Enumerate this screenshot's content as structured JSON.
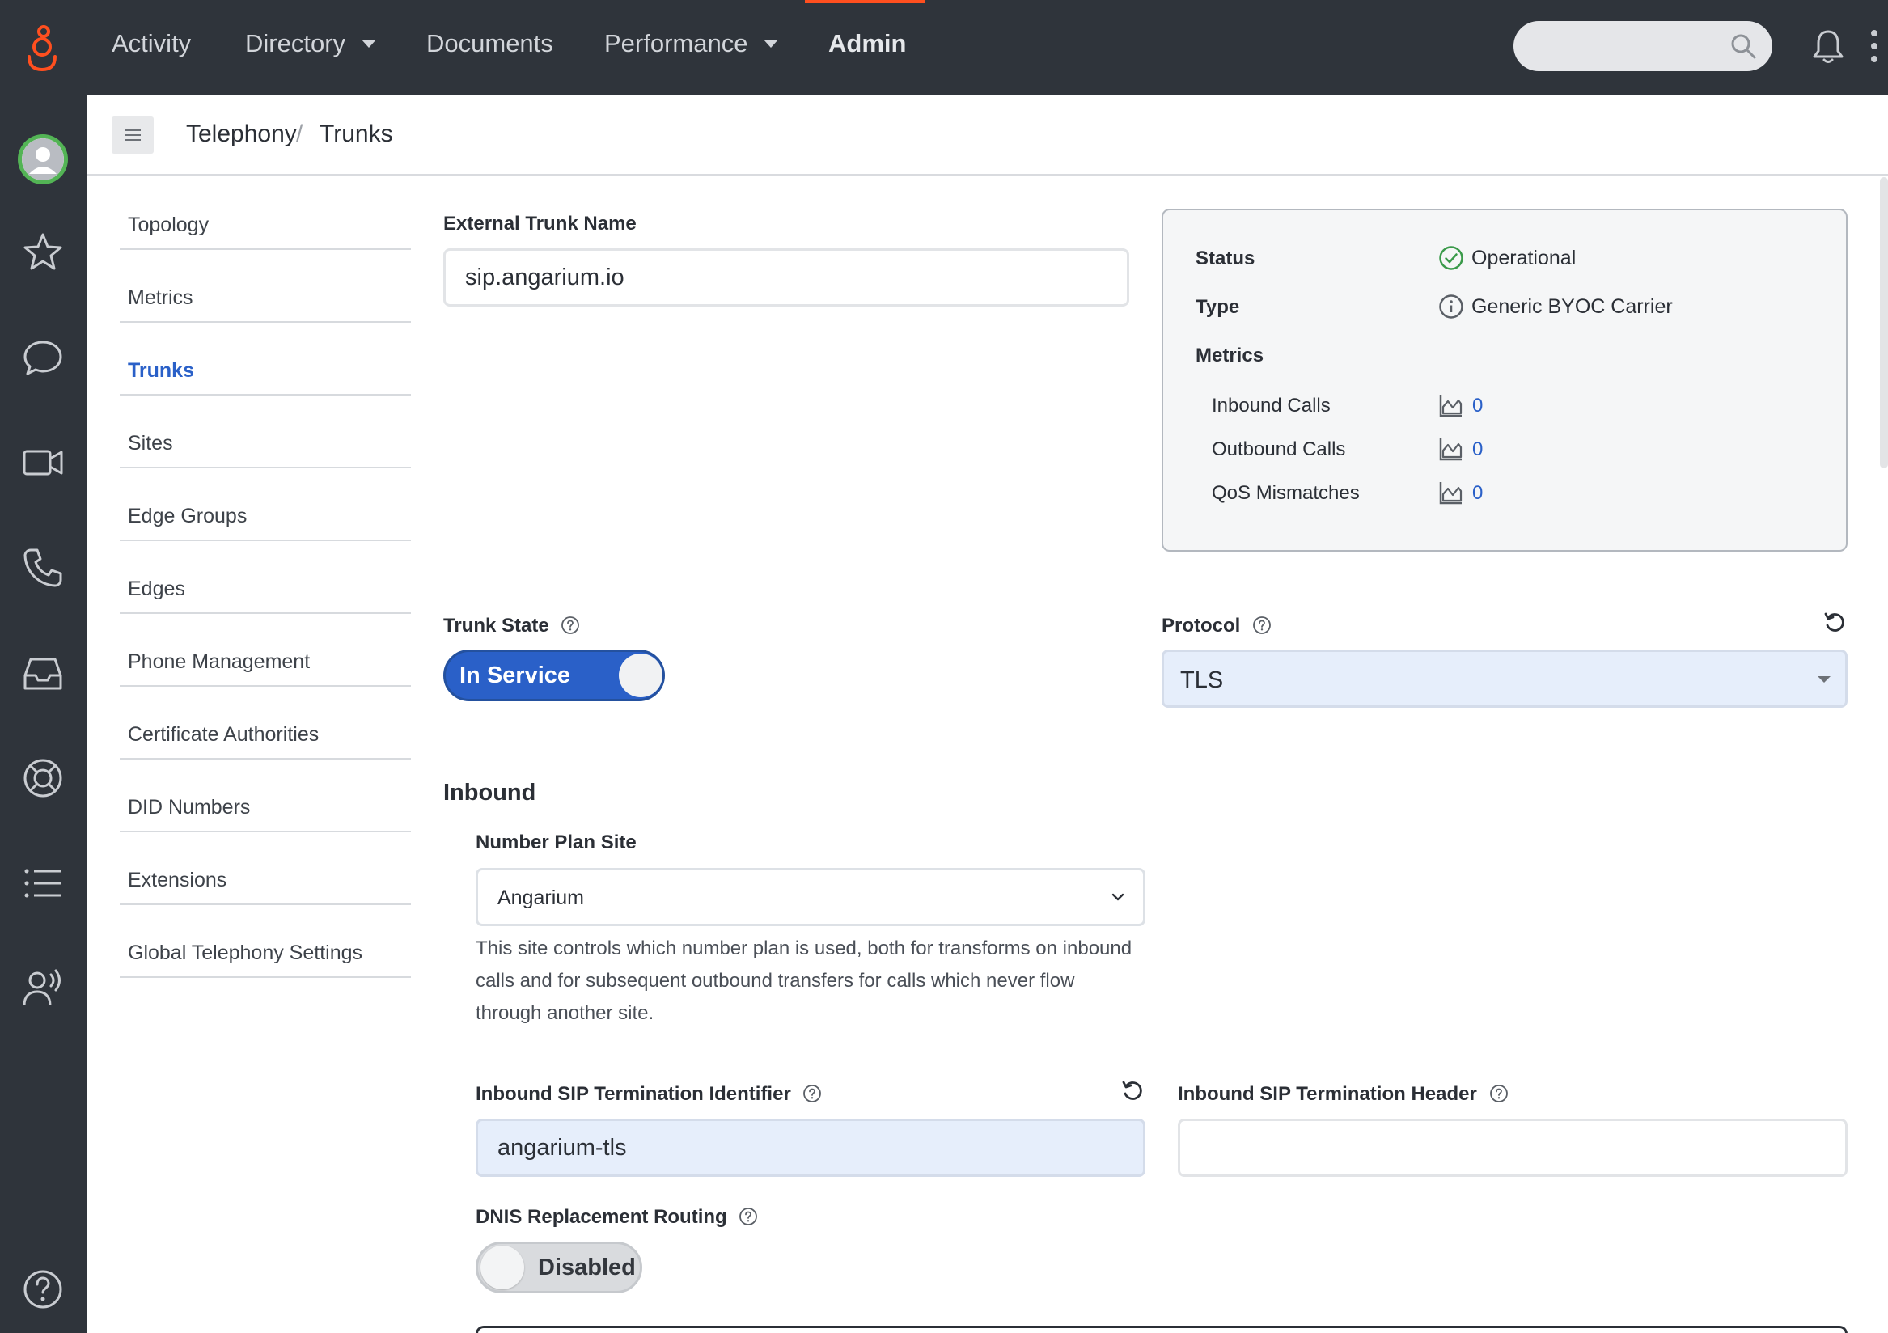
{
  "topnav": {
    "items": [
      {
        "label": "Activity"
      },
      {
        "label": "Directory"
      },
      {
        "label": "Documents"
      },
      {
        "label": "Performance"
      },
      {
        "label": "Admin"
      }
    ],
    "search_placeholder": ""
  },
  "breadcrumb": {
    "parent": "Telephony",
    "separator": "/",
    "current": "Trunks"
  },
  "subnav": {
    "items": [
      {
        "label": "Topology"
      },
      {
        "label": "Metrics"
      },
      {
        "label": "Trunks",
        "active": true
      },
      {
        "label": "Sites"
      },
      {
        "label": "Edge Groups"
      },
      {
        "label": "Edges"
      },
      {
        "label": "Phone Management"
      },
      {
        "label": "Certificate Authorities"
      },
      {
        "label": "DID Numbers"
      },
      {
        "label": "Extensions"
      },
      {
        "label": "Global Telephony Settings"
      }
    ]
  },
  "external_trunk_name": {
    "label": "External Trunk Name",
    "value": "sip.angarium.io"
  },
  "status_panel": {
    "status_label": "Status",
    "status_value": "Operational",
    "type_label": "Type",
    "type_value": "Generic BYOC Carrier",
    "metrics_label": "Metrics",
    "metrics": [
      {
        "label": "Inbound Calls",
        "value": "0"
      },
      {
        "label": "Outbound Calls",
        "value": "0"
      },
      {
        "label": "QoS Mismatches",
        "value": "0"
      }
    ]
  },
  "trunk_state": {
    "label": "Trunk State",
    "value": "In Service"
  },
  "protocol": {
    "label": "Protocol",
    "value": "TLS"
  },
  "inbound": {
    "title": "Inbound",
    "number_plan_site_label": "Number Plan Site",
    "number_plan_site_value": "Angarium",
    "number_plan_site_help_1": "This site controls which number plan is used, both for transforms on inbound",
    "number_plan_site_help_2": "calls and for subsequent outbound transfers for calls which never flow",
    "number_plan_site_help_3": "through another site.",
    "sip_termination_identifier_label": "Inbound SIP Termination Identifier",
    "sip_termination_identifier_value": "angarium-tls",
    "sip_termination_header_label": "Inbound SIP Termination Header",
    "sip_termination_header_value": "",
    "dnis_label": "DNIS Replacement Routing",
    "dnis_value": "Disabled"
  },
  "colors": {
    "topbar": "#2f343b",
    "accent_blue": "#2a60c8",
    "admin_indicator": "#ff4f1f",
    "success_green": "#3a9a4a",
    "logo_orange": "#ff4f1f"
  }
}
